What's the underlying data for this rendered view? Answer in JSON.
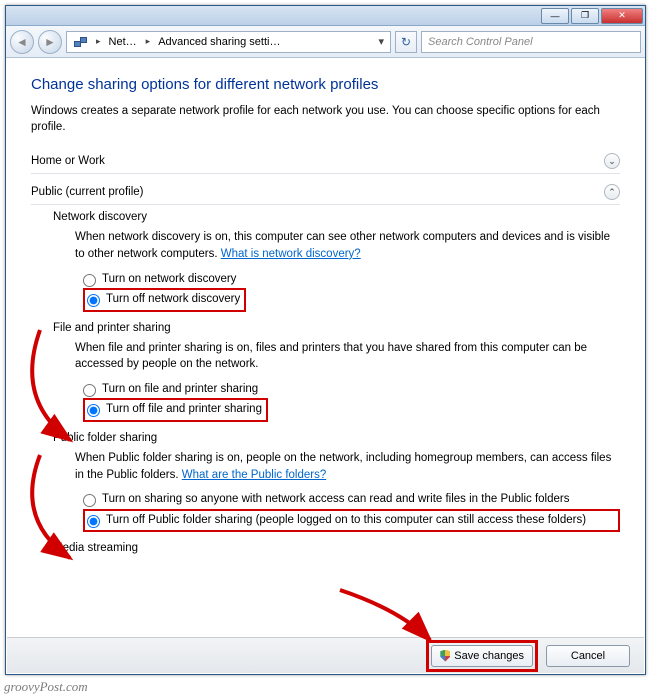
{
  "titlebar": {
    "minimize": "—",
    "maximize": "❐",
    "close": "✕"
  },
  "nav": {
    "back": "◄",
    "forward": "►",
    "crumb1": "Net…",
    "crumb2": "Advanced sharing setti…",
    "refresh": "↻",
    "search_placeholder": "Search Control Panel"
  },
  "page": {
    "title": "Change sharing options for different network profiles",
    "desc": "Windows creates a separate network profile for each network you use. You can choose specific options for each profile."
  },
  "sections": {
    "home": {
      "label": "Home or Work",
      "expanded": false
    },
    "public": {
      "label": "Public (current profile)",
      "expanded": true
    }
  },
  "netdisc": {
    "title": "Network discovery",
    "desc": "When network discovery is on, this computer can see other network computers and devices and is visible to other network computers. ",
    "link": "What is network discovery?",
    "on_label": "Turn on network discovery",
    "off_label": "Turn off network discovery"
  },
  "fileprint": {
    "title": "File and printer sharing",
    "desc": "When file and printer sharing is on, files and printers that you have shared from this computer can be accessed by people on the network.",
    "on_label": "Turn on file and printer sharing",
    "off_label": "Turn off file and printer sharing"
  },
  "pubfolder": {
    "title": "Public folder sharing",
    "desc": "When Public folder sharing is on, people on the network, including homegroup members, can access files in the Public folders. ",
    "link": "What are the Public folders?",
    "on_label": "Turn on sharing so anyone with network access can read and write files in the Public folders",
    "off_label": "Turn off Public folder sharing (people logged on to this computer can still access these folders)"
  },
  "media": {
    "title": "Media streaming"
  },
  "buttons": {
    "save": "Save changes",
    "cancel": "Cancel"
  },
  "watermark": "groovyPost.com"
}
